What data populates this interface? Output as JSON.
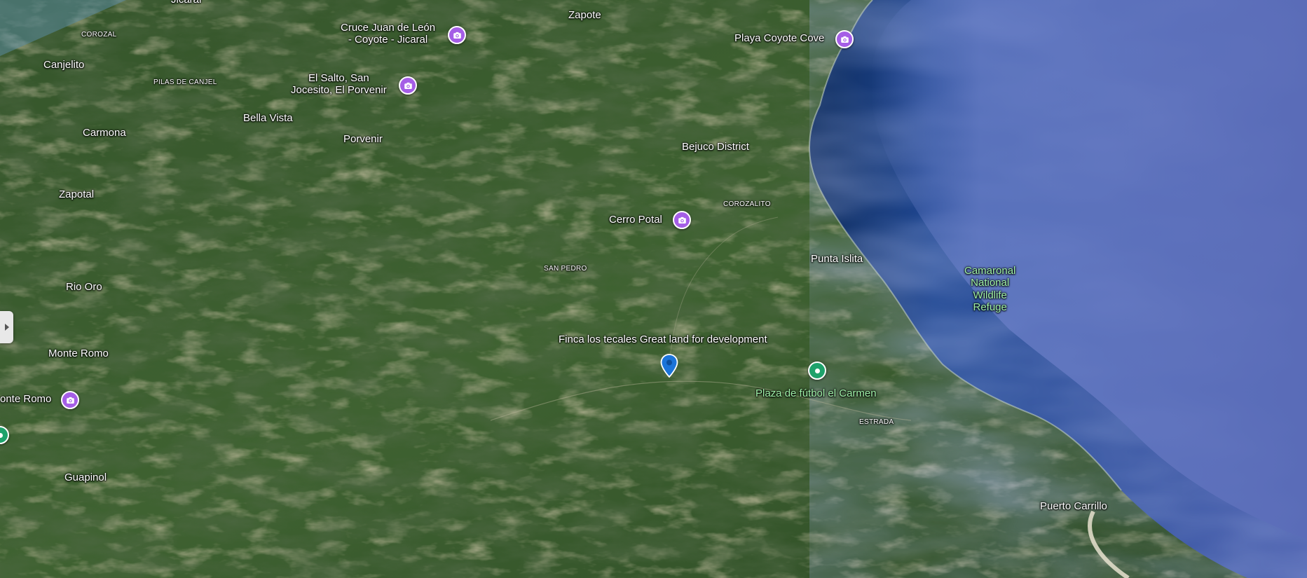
{
  "colors": {
    "land_dark": "#1f3a1c",
    "land_mid": "#3f6231",
    "land_dry": "#8a7f56",
    "ocean_deep": "#1a3f7a",
    "ocean_haze": "#5a6fb8",
    "photo_marker": "#a55ee6",
    "place_marker": "#1ea26b",
    "selected_pin": "#1b74d9",
    "park_label": "#9ff0a8"
  },
  "towns": {
    "jicaral": "Jicaral",
    "zapote": "Zapote",
    "canjelito": "Canjelito",
    "carmona": "Carmona",
    "bella_vista": "Bella Vista",
    "porvenir": "Porvenir",
    "bejuco": "Bejuco District",
    "zapotal": "Zapotal",
    "punta_islita": "Punta Islita",
    "rio_oro": "Rio Oro",
    "monte_romo": "Monte Romo",
    "guapinol": "Guapinol",
    "puerto_carrillo": "Puerto Carrillo"
  },
  "districts": {
    "corozal": "COROZAL",
    "pilas": "PILAS DE CANJEL",
    "corozalito": "COROZALITO",
    "san_pedro": "SAN PEDRO",
    "estrada": "ESTRADA"
  },
  "photo_points": {
    "cruce": [
      "Cruce Juan de León",
      "- Coyote - Jicaral"
    ],
    "playa": "Playa Coyote Cove",
    "el_salto": [
      "El Salto, San",
      "Jocesito, El Porvenir"
    ],
    "cerro": "Cerro Potal",
    "monte_romo": "onte Romo"
  },
  "selected_place": "Finca los tecales Great land for development",
  "green_place": "Plaza de fútbol el Carmen",
  "park": [
    "Camaronal",
    "National",
    "Wildlife",
    "Refuge"
  ],
  "icons": {
    "photo": "camera-icon",
    "pin": "map-pin-icon",
    "place": "place-dot-icon",
    "toggle": "chevron-right-icon"
  }
}
